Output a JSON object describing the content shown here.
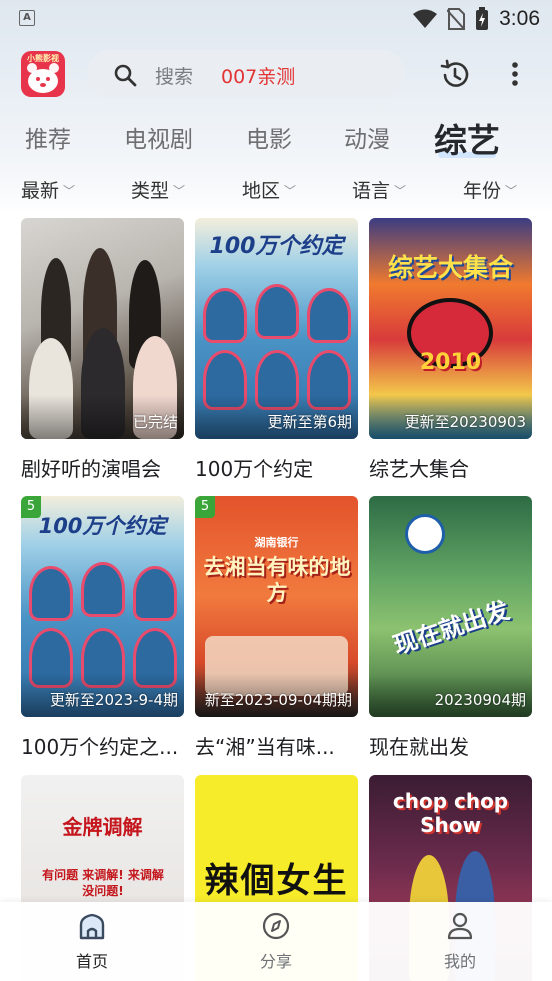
{
  "status_bar": {
    "time": "3:06",
    "left_icon_letter": "A"
  },
  "header": {
    "logo_text": "小熊影视",
    "search_placeholder": "搜索",
    "search_hot": "007亲测"
  },
  "tabs": [
    {
      "label": "推荐",
      "active": false
    },
    {
      "label": "电视剧",
      "active": false
    },
    {
      "label": "电影",
      "active": false
    },
    {
      "label": "动漫",
      "active": false
    },
    {
      "label": "综艺",
      "active": true
    }
  ],
  "filters": [
    {
      "label": "最新"
    },
    {
      "label": "类型"
    },
    {
      "label": "地区"
    },
    {
      "label": "语言"
    },
    {
      "label": "年份"
    }
  ],
  "cards": [
    {
      "title": "剧好听的演唱会",
      "status": "已完结",
      "badge": ""
    },
    {
      "title": "100万个约定",
      "status": "更新至第6期",
      "badge": "",
      "art_text": "100万个约定"
    },
    {
      "title": "综艺大集合",
      "status": "更新至20230903",
      "badge": "",
      "art_text": "综艺大集合",
      "art_year": "2010"
    },
    {
      "title": "100万个约定之...",
      "status": "更新至2023-9-4期",
      "badge": "5",
      "art_text": "100万个约定"
    },
    {
      "title": "去“湘”当有味...",
      "status": "新至2023-09-04期期",
      "badge": "5",
      "art_text": "去湘当有味的地方",
      "art_sub": "湖南银行"
    },
    {
      "title": "现在就出发",
      "status": "20230904期",
      "badge": "",
      "art_text": "现在就出发"
    },
    {
      "title": "",
      "status": "",
      "badge": "",
      "art_text": "金牌调解",
      "art_sub": "有问题 来调解! 来调解 没问题!"
    },
    {
      "title": "",
      "status": "",
      "badge": "",
      "art_text": "辣個女生"
    },
    {
      "title": "",
      "status": "",
      "badge": "",
      "art_text": "chop chop Show"
    }
  ],
  "bottom_nav": [
    {
      "label": "首页",
      "icon": "home-icon",
      "active": true
    },
    {
      "label": "分享",
      "icon": "compass-icon",
      "active": false
    },
    {
      "label": "我的",
      "icon": "person-icon",
      "active": false
    }
  ]
}
